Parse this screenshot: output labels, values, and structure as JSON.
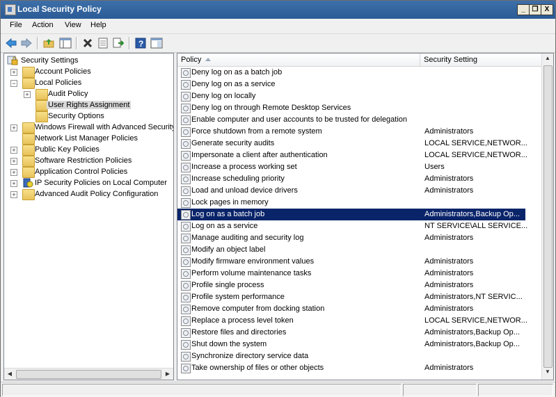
{
  "window": {
    "title": "Local Security Policy"
  },
  "window_controls": {
    "minimize": "_",
    "restore": "❐",
    "close": "X"
  },
  "menu": [
    "File",
    "Action",
    "View",
    "Help"
  ],
  "toolbar": {
    "buttons": [
      "back-icon",
      "forward-icon",
      "up-folder-icon",
      "show-hide-tree-icon",
      "delete-icon",
      "properties-icon",
      "export-list-icon",
      "help-icon",
      "show-pane-icon"
    ]
  },
  "tree": {
    "root": "Security Settings",
    "items": [
      {
        "label": "Account Policies",
        "expander": "+"
      },
      {
        "label": "Local Policies",
        "expander": "−"
      },
      {
        "label": "Audit Policy",
        "expander": "+"
      },
      {
        "label": "User Rights Assignment",
        "expander": ""
      },
      {
        "label": "Security Options",
        "expander": ""
      },
      {
        "label": "Windows Firewall with Advanced Security",
        "expander": "+"
      },
      {
        "label": "Network List Manager Policies",
        "expander": ""
      },
      {
        "label": "Public Key Policies",
        "expander": "+"
      },
      {
        "label": "Software Restriction Policies",
        "expander": "+"
      },
      {
        "label": "Application Control Policies",
        "expander": "+"
      },
      {
        "label": "IP Security Policies on Local Computer",
        "expander": "+"
      },
      {
        "label": "Advanced Audit Policy Configuration",
        "expander": "+"
      }
    ],
    "selected": "User Rights Assignment"
  },
  "list": {
    "columns": [
      "Policy",
      "Security Setting"
    ],
    "rows": [
      {
        "policy": "Deny log on as a batch job",
        "setting": ""
      },
      {
        "policy": "Deny log on as a service",
        "setting": ""
      },
      {
        "policy": "Deny log on locally",
        "setting": ""
      },
      {
        "policy": "Deny log on through Remote Desktop Services",
        "setting": ""
      },
      {
        "policy": "Enable computer and user accounts to be trusted for delegation",
        "setting": ""
      },
      {
        "policy": "Force shutdown from a remote system",
        "setting": "Administrators"
      },
      {
        "policy": "Generate security audits",
        "setting": "LOCAL SERVICE,NETWOR..."
      },
      {
        "policy": "Impersonate a client after authentication",
        "setting": "LOCAL SERVICE,NETWOR..."
      },
      {
        "policy": "Increase a process working set",
        "setting": "Users"
      },
      {
        "policy": "Increase scheduling priority",
        "setting": "Administrators"
      },
      {
        "policy": "Load and unload device drivers",
        "setting": "Administrators"
      },
      {
        "policy": "Lock pages in memory",
        "setting": ""
      },
      {
        "policy": "Log on as a batch job",
        "setting": "Administrators,Backup Op..."
      },
      {
        "policy": "Log on as a service",
        "setting": "NT SERVICE\\ALL SERVICE..."
      },
      {
        "policy": "Manage auditing and security log",
        "setting": "Administrators"
      },
      {
        "policy": "Modify an object label",
        "setting": ""
      },
      {
        "policy": "Modify firmware environment values",
        "setting": "Administrators"
      },
      {
        "policy": "Perform volume maintenance tasks",
        "setting": "Administrators"
      },
      {
        "policy": "Profile single process",
        "setting": "Administrators"
      },
      {
        "policy": "Profile system performance",
        "setting": "Administrators,NT SERVIC..."
      },
      {
        "policy": "Remove computer from docking station",
        "setting": "Administrators"
      },
      {
        "policy": "Replace a process level token",
        "setting": "LOCAL SERVICE,NETWOR..."
      },
      {
        "policy": "Restore files and directories",
        "setting": "Administrators,Backup Op..."
      },
      {
        "policy": "Shut down the system",
        "setting": "Administrators,Backup Op..."
      },
      {
        "policy": "Synchronize directory service data",
        "setting": ""
      },
      {
        "policy": "Take ownership of files or other objects",
        "setting": "Administrators"
      }
    ],
    "selected_policy": "Log on as a batch job"
  },
  "colors": {
    "titlebar": "#2b5b96",
    "selection": "#0a246a",
    "folder": "#e8c25a"
  }
}
